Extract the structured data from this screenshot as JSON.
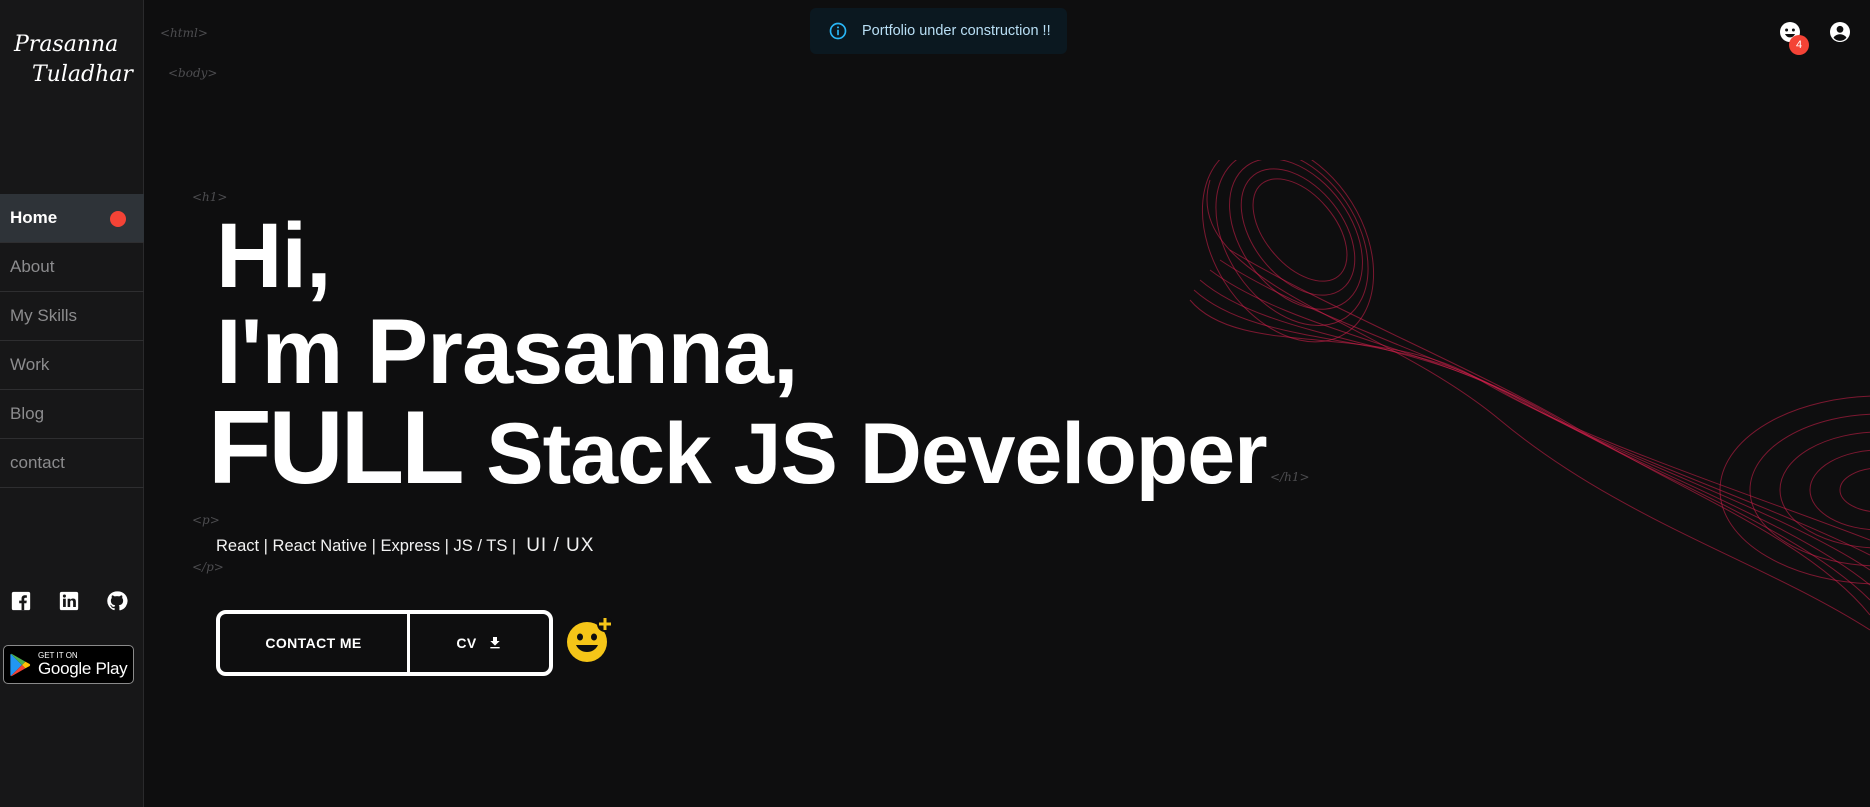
{
  "logo": {
    "line1": "Prasanna",
    "line2": "Tuladhar"
  },
  "nav": {
    "items": [
      {
        "label": "Home",
        "active": true
      },
      {
        "label": "About"
      },
      {
        "label": "My Skills"
      },
      {
        "label": "Work"
      },
      {
        "label": "Blog"
      },
      {
        "label": "contact"
      }
    ]
  },
  "socials": [
    "facebook-icon",
    "linkedin-icon",
    "github-icon"
  ],
  "google_play": {
    "small": "GET IT ON",
    "big": "Google Play"
  },
  "tags": {
    "html_open": "<html>",
    "body_open": "<body>",
    "h1_open": "<h1>",
    "h1_close": "</h1>",
    "p_open": "<p>",
    "p_close": "</p>"
  },
  "toast": {
    "text": "Portfolio under construction !!",
    "icon": "info-icon"
  },
  "notifications": {
    "count": "4"
  },
  "hero": {
    "line1": "Hi,",
    "line2": "I'm Prasanna,",
    "line3_full": "FULL",
    "line3_rest": "Stack JS Developer"
  },
  "skills": {
    "text": "React | React Native | Express | JS / TS |",
    "rotating": "UI / UX"
  },
  "buttons": {
    "contact": "CONTACT ME",
    "cv": "CV"
  },
  "colors": {
    "accent_red": "#f44336",
    "background": "#0e0e0f",
    "emoji_yellow": "#f5c518"
  }
}
